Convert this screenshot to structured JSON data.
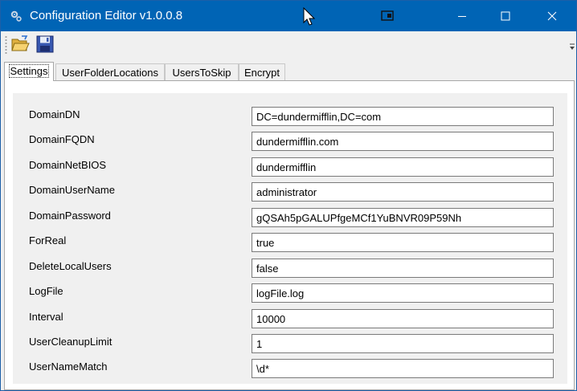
{
  "window": {
    "title": "Configuration Editor v1.0.0.8",
    "titlebar_color": "#0064b5",
    "controls": [
      "minimize-icon",
      "maximize-icon",
      "close-icon"
    ]
  },
  "toolbar": {
    "buttons": [
      {
        "name": "open",
        "icon": "open-folder-icon"
      },
      {
        "name": "save",
        "icon": "floppy-disk-icon"
      }
    ]
  },
  "tabs": [
    {
      "label": "Settings",
      "active": true
    },
    {
      "label": "UserFolderLocations",
      "active": false
    },
    {
      "label": "UsersToSkip",
      "active": false
    },
    {
      "label": "Encrypt",
      "active": false
    }
  ],
  "settings": [
    {
      "label": "DomainDN",
      "value": "DC=dundermifflin,DC=com"
    },
    {
      "label": "DomainFQDN",
      "value": "dundermifflin.com"
    },
    {
      "label": "DomainNetBIOS",
      "value": "dundermifflin"
    },
    {
      "label": "DomainUserName",
      "value": "administrator"
    },
    {
      "label": "DomainPassword",
      "value": "gQSAh5pGALUPfgeMCf1YuBNVR09P59Nh"
    },
    {
      "label": "ForReal",
      "value": "true"
    },
    {
      "label": "DeleteLocalUsers",
      "value": "false"
    },
    {
      "label": "LogFile",
      "value": "logFile.log"
    },
    {
      "label": "Interval",
      "value": "10000"
    },
    {
      "label": "UserCleanupLimit",
      "value": "1"
    },
    {
      "label": "UserNameMatch",
      "value": "\\d*"
    }
  ]
}
